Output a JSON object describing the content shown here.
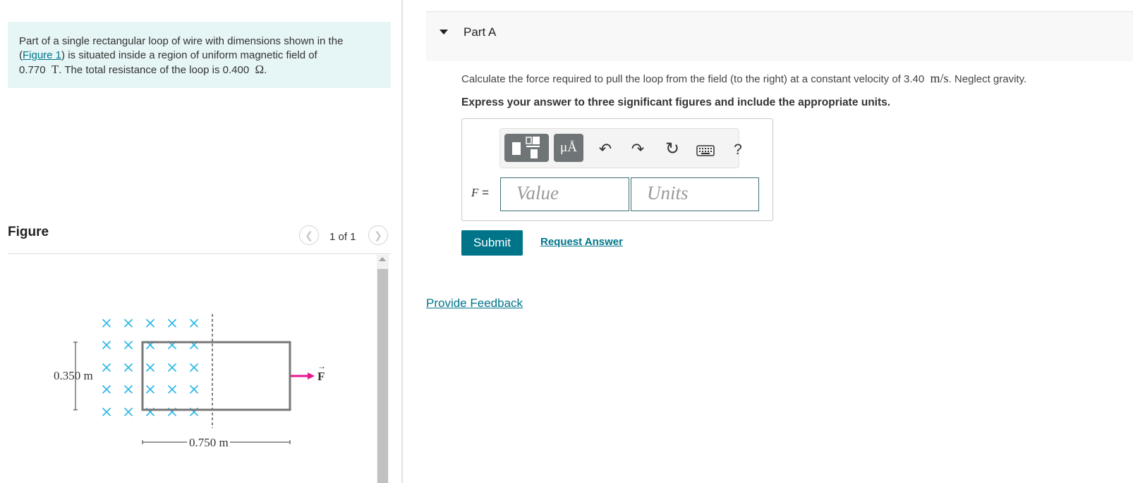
{
  "problem": {
    "text_before_link": "Part of a single rectangular loop of wire with dimensions shown in the (",
    "figure_link": "Figure 1",
    "text_after_link": ") is situated inside a region of uniform magnetic field of",
    "field_value": "0.770",
    "field_unit": "T",
    "resistance_text": ". The total resistance of the loop is 0.400",
    "resistance_unit": "Ω",
    "end": "."
  },
  "figure": {
    "title": "Figure",
    "counter": "1 of 1",
    "prev_icon": "chevron-left-icon",
    "next_icon": "chevron-right-icon",
    "height_label": "0.350 m",
    "width_label": "0.750 m",
    "force_label": "F",
    "field_color": "#29b6e6",
    "force_color": "#e6198a"
  },
  "part": {
    "title": "Part A",
    "question_before": "Calculate the force required to pull the loop from the field (to the right) at a constant velocity of 3.40",
    "velocity_unit": "m/s",
    "question_after": ". Neglect gravity.",
    "instruction": "Express your answer to three significant figures and include the appropriate units."
  },
  "toolbar": {
    "templates_icon": "templates-icon",
    "units_button": "μÅ",
    "undo_icon": "undo-icon",
    "redo_icon": "redo-icon",
    "reset_icon": "reset-icon",
    "keyboard_icon": "keyboard-icon",
    "help": "?"
  },
  "answer": {
    "label_var": "F",
    "label_eq": "=",
    "value_placeholder": "Value",
    "units_placeholder": "Units"
  },
  "actions": {
    "submit": "Submit",
    "request_answer": "Request Answer",
    "feedback": "Provide Feedback"
  },
  "colors": {
    "accent": "#00758a",
    "problem_bg": "#e6f5f6"
  }
}
